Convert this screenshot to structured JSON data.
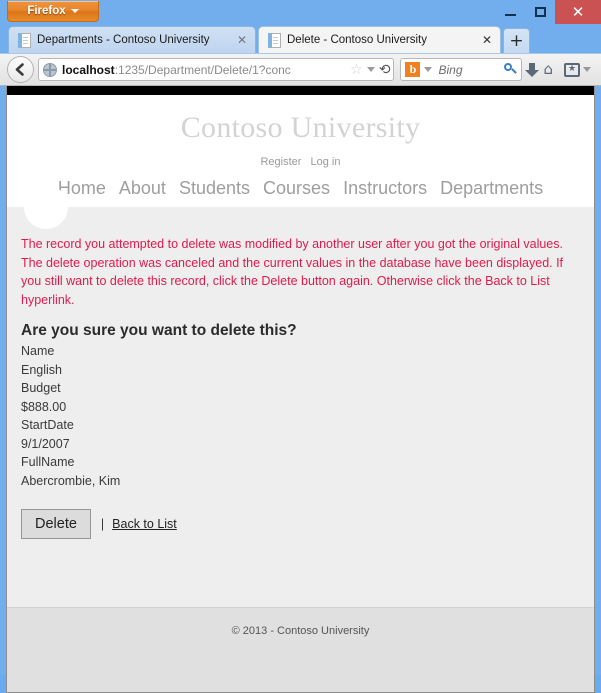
{
  "browser": {
    "app_button": "Firefox",
    "window_controls": {
      "minimize": "–",
      "maximize": "□",
      "close": "✕"
    },
    "tabs": [
      {
        "title": "Departments - Contoso University",
        "close": "✕",
        "active": false
      },
      {
        "title": "Delete - Contoso University",
        "close": "✕",
        "active": true
      }
    ],
    "new_tab_label": "+",
    "back_label": "←",
    "url": {
      "host": "localhost",
      "path": ":1235/Department/Delete/1?conc"
    },
    "url_icons": {
      "star": "☆",
      "dropdown": "▾",
      "reload": "⟳"
    },
    "search": {
      "engine_letter": "b",
      "engine_caret": "▾",
      "placeholder": "Bing"
    },
    "toolbar_icons": {
      "bookmarks_star": "★",
      "bookmarks_caret": "▾"
    }
  },
  "page": {
    "site_title": "Contoso University",
    "auth_links": [
      {
        "label": "Register"
      },
      {
        "label": "Log in"
      }
    ],
    "nav_links": [
      {
        "label": "Home"
      },
      {
        "label": "About"
      },
      {
        "label": "Students"
      },
      {
        "label": "Courses"
      },
      {
        "label": "Instructors"
      },
      {
        "label": "Departments"
      }
    ],
    "alert": "The record you attempted to delete was modified by another user after you got the original values. The delete operation was canceled and the current values in the database have been displayed. If you still want to delete this record, click the Delete button again. Otherwise click the Back to List hyperlink.",
    "confirm_heading": "Are you sure you want to delete this?",
    "fields": [
      {
        "label": "Name",
        "value": "English"
      },
      {
        "label": "Budget",
        "value": "$888.00"
      },
      {
        "label": "StartDate",
        "value": "9/1/2007"
      },
      {
        "label": "FullName",
        "value": "Abercrombie, Kim"
      }
    ],
    "delete_button": "Delete",
    "separator": "|",
    "back_to_list": "Back to List",
    "footer": "© 2013 - Contoso University"
  },
  "colors": {
    "chrome_blue": "#72aeee",
    "firefox_orange": "#e8832a",
    "alert_red": "#e01b4c",
    "close_red": "#cb5252"
  }
}
